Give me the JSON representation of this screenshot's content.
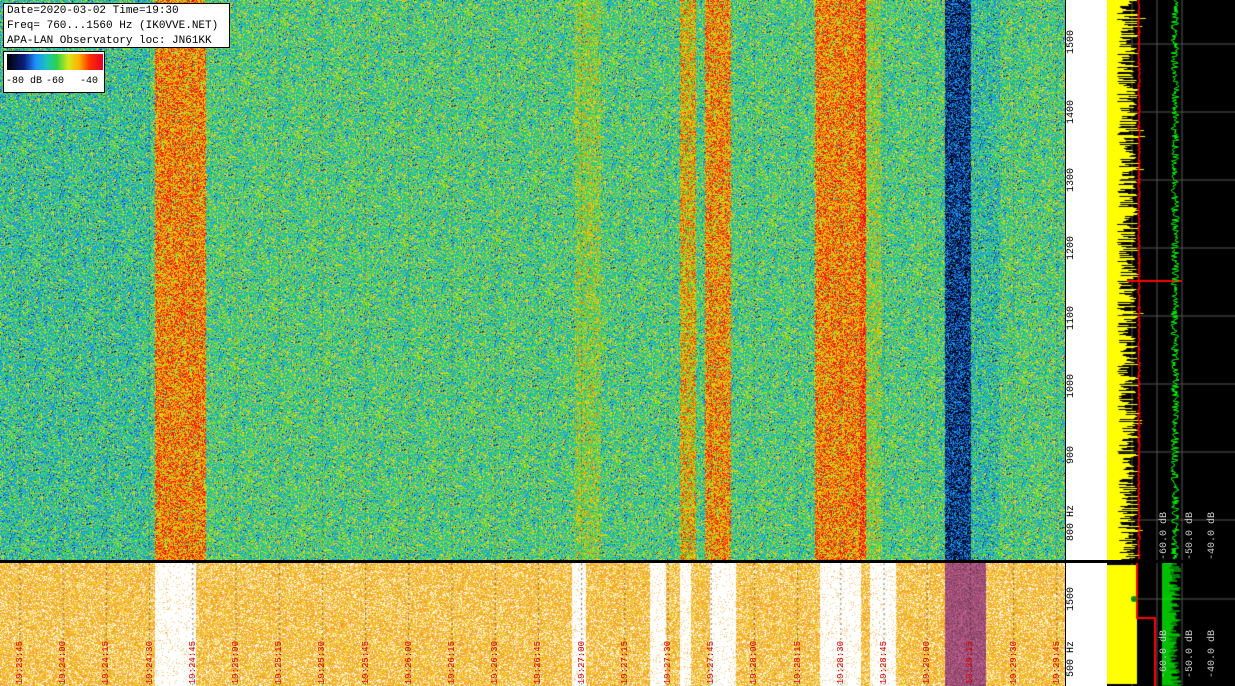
{
  "header": {
    "line1": "Date=2020-03-02 Time=19:30",
    "line2": "Freq= 760...1560 Hz (IK0VVE.NET)",
    "line3": "APA-LAN Observatory loc: JN61KK"
  },
  "color_scale": {
    "label_min": "-80 dB",
    "label_mid": "-60",
    "label_max": "-40"
  },
  "freq_axis_top": {
    "ticks": [
      "1500",
      "1400",
      "1300",
      "1200",
      "1100",
      "1000",
      "900",
      "800 Hz"
    ],
    "values_hz": [
      1500,
      1400,
      1300,
      1200,
      1100,
      1000,
      900,
      800
    ]
  },
  "freq_axis_bottom": {
    "ticks": [
      "1500",
      "500 Hz"
    ],
    "values_hz": [
      1500,
      500
    ]
  },
  "time_axis": {
    "labels": [
      "19:23:45",
      "19:24:00",
      "19:24:15",
      "19:24:30",
      "19:24:45",
      "19:25:00",
      "19:25:15",
      "19:25:30",
      "19:25:45",
      "19:26:00",
      "19:26:15",
      "19:26:30",
      "19:26:45",
      "19:27:00",
      "19:27:15",
      "19:27:30",
      "19:27:45",
      "19:28:00",
      "19:28:15",
      "19:28:30",
      "19:28:45",
      "19:29:00",
      "19:29:15",
      "19:29:30",
      "19:29:45"
    ]
  },
  "spectrum_labels": {
    "top": [
      "-60.0 dB",
      "-50.0 dB",
      "-40.0 dB"
    ],
    "bottom": [
      "-60.0 dB",
      "-50.0 dB",
      "-40.0 dB"
    ]
  },
  "colors": {
    "waterfall_low": "#0b2080",
    "waterfall_mid": "#2ed14a",
    "waterfall_high": "#ff3000",
    "spectrum_yellow": "#ffff00",
    "spectrum_green": "#00ff00",
    "marker_red": "#ff0000",
    "time_label": "#d40000"
  }
}
